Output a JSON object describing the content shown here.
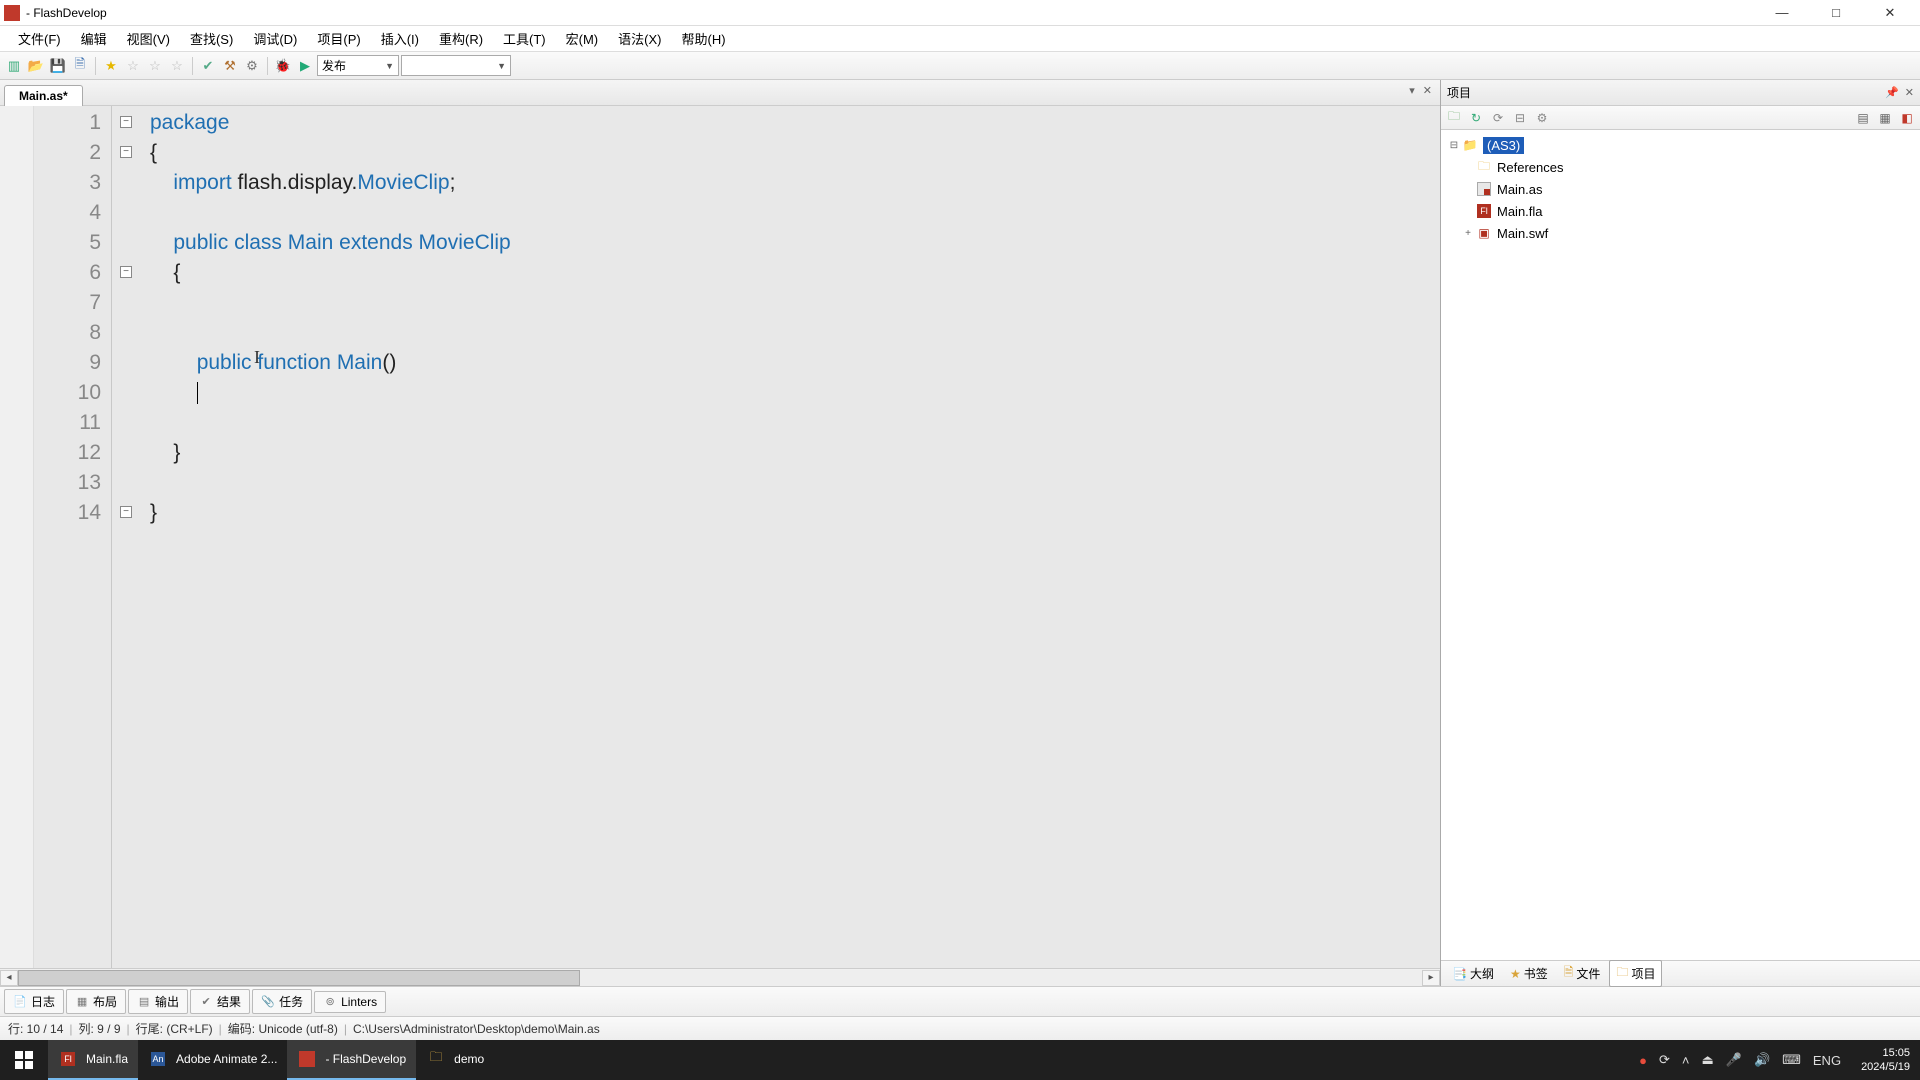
{
  "titlebar": {
    "title": " - FlashDevelop"
  },
  "menus": [
    "文件(F)",
    "编辑",
    "视图(V)",
    "查找(S)",
    "调试(D)",
    "项目(P)",
    "插入(I)",
    "重构(R)",
    "工具(T)",
    "宏(M)",
    "语法(X)",
    "帮助(H)"
  ],
  "toolbar": {
    "build_label": "发布"
  },
  "tab": {
    "name": "Main.as*"
  },
  "code_lines": [
    [
      {
        "t": "package",
        "c": "kw"
      }
    ],
    [
      {
        "t": "{",
        "c": "plain"
      }
    ],
    [
      {
        "t": "    ",
        "c": "plain"
      },
      {
        "t": "import",
        "c": "kw"
      },
      {
        "t": " flash.display.",
        "c": "plain"
      },
      {
        "t": "MovieClip",
        "c": "type"
      },
      {
        "t": ";",
        "c": "plain"
      }
    ],
    [],
    [
      {
        "t": "    ",
        "c": "plain"
      },
      {
        "t": "public",
        "c": "kw"
      },
      {
        "t": " ",
        "c": "plain"
      },
      {
        "t": "class",
        "c": "kw"
      },
      {
        "t": " ",
        "c": "plain"
      },
      {
        "t": "Main",
        "c": "ident"
      },
      {
        "t": " ",
        "c": "plain"
      },
      {
        "t": "extends",
        "c": "kw"
      },
      {
        "t": " ",
        "c": "plain"
      },
      {
        "t": "MovieClip",
        "c": "type"
      }
    ],
    [
      {
        "t": "    {",
        "c": "plain"
      }
    ],
    [],
    [],
    [
      {
        "t": "        ",
        "c": "plain"
      },
      {
        "t": "public",
        "c": "kw"
      },
      {
        "t": " ",
        "c": "plain"
      },
      {
        "t": "function",
        "c": "kw"
      },
      {
        "t": " ",
        "c": "plain"
      },
      {
        "t": "Main",
        "c": "ident"
      },
      {
        "t": "()",
        "c": "plain"
      }
    ],
    [
      {
        "t": "        ",
        "c": "plain"
      }
    ],
    [],
    [
      {
        "t": "    }",
        "c": "plain"
      }
    ],
    [],
    [
      {
        "t": "}",
        "c": "plain"
      }
    ]
  ],
  "cursor_line_index": 9,
  "text_caret_line_index": 8,
  "line_count": 14,
  "project": {
    "title": "项目",
    "root": "(AS3)",
    "nodes": [
      {
        "label": "References",
        "icon": "folder",
        "exp": ""
      },
      {
        "label": "Main.as",
        "icon": "as",
        "exp": ""
      },
      {
        "label": "Main.fla",
        "icon": "fla",
        "exp": ""
      },
      {
        "label": "Main.swf",
        "icon": "swf",
        "exp": "+"
      }
    ],
    "bottom_tabs": [
      "大纲",
      "书签",
      "文件",
      "项目"
    ],
    "bottom_active": "项目"
  },
  "bottom_tabs": [
    "日志",
    "布局",
    "输出",
    "结果",
    "任务",
    "Linters"
  ],
  "status": {
    "pos": "行: 10 / 14",
    "col": "列: 9 / 9",
    "eol": "行尾: (CR+LF)",
    "enc": "编码: Unicode (utf-8)",
    "path": "C:\\Users\\Administrator\\Desktop\\demo\\Main.as"
  },
  "taskbar": {
    "items": [
      {
        "label": "Main.fla",
        "icon": "fla",
        "active": true
      },
      {
        "label": "Adobe Animate 2...",
        "icon": "an",
        "active": false
      },
      {
        "label": " - FlashDevelop",
        "icon": "fd",
        "active": true
      },
      {
        "label": "demo",
        "icon": "folder",
        "active": false
      }
    ],
    "lang": "ENG",
    "time": "15:05",
    "date": "2024/5/19"
  }
}
